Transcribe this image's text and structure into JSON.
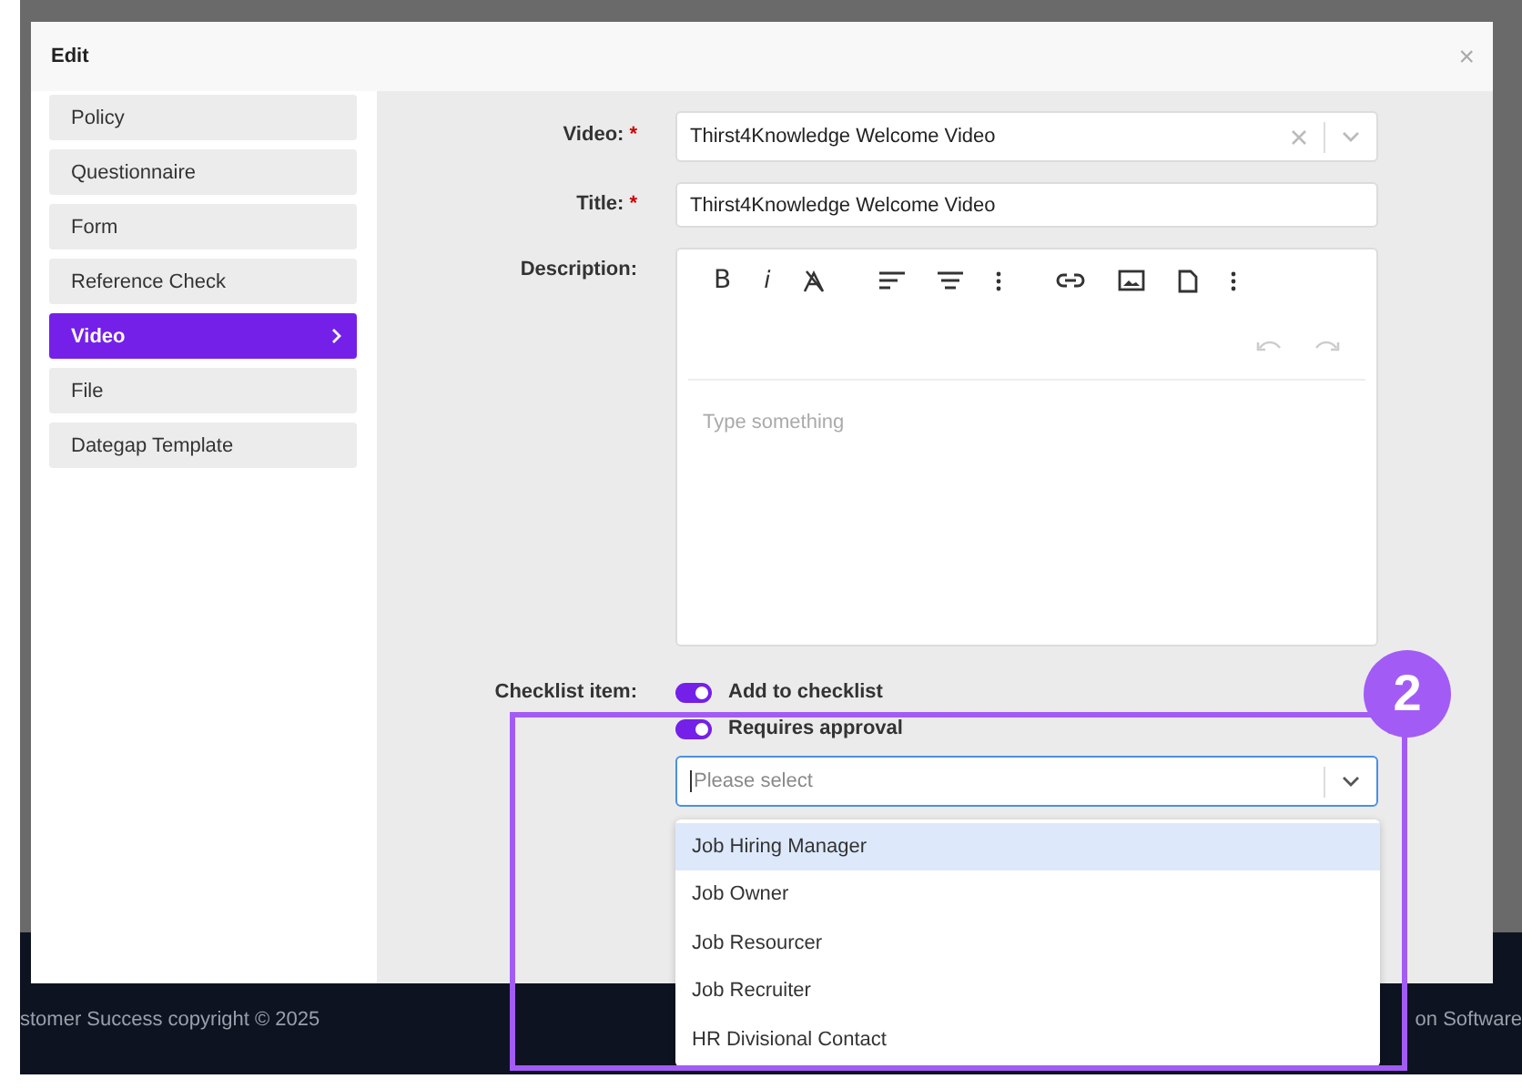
{
  "dialog": {
    "title": "Edit",
    "close": "×"
  },
  "sidebar": {
    "items": [
      {
        "label": "Policy",
        "selected": false
      },
      {
        "label": "Questionnaire",
        "selected": false
      },
      {
        "label": "Form",
        "selected": false
      },
      {
        "label": "Reference Check",
        "selected": false
      },
      {
        "label": "Video",
        "selected": true
      },
      {
        "label": "File",
        "selected": false
      },
      {
        "label": "Dategap Template",
        "selected": false
      }
    ]
  },
  "form": {
    "video": {
      "label": "Video:",
      "required_mark": "*",
      "value": "Thirst4Knowledge Welcome Video"
    },
    "title": {
      "label": "Title:",
      "required_mark": "*",
      "value": "Thirst4Knowledge Welcome Video"
    },
    "description": {
      "label": "Description:",
      "format_buttons": [
        "B",
        "i"
      ],
      "placeholder": "Type something"
    },
    "checklist": {
      "label": "Checklist item:",
      "toggles": [
        {
          "label": "Add to checklist",
          "on": true
        },
        {
          "label": "Requires approval",
          "on": true
        }
      ],
      "approver_select": {
        "placeholder": "Please select",
        "options": [
          {
            "label": "Job Hiring Manager",
            "selected": true
          },
          {
            "label": "Job Owner",
            "selected": false
          },
          {
            "label": "Job Resourcer",
            "selected": false
          },
          {
            "label": "Job Recruiter",
            "selected": false
          },
          {
            "label": "HR Divisional Contact",
            "selected": false
          }
        ]
      }
    }
  },
  "background_footer": {
    "copyright": "stomer Success copyright © 2025",
    "tagline": "on Software"
  },
  "annotation": {
    "number": "2"
  }
}
